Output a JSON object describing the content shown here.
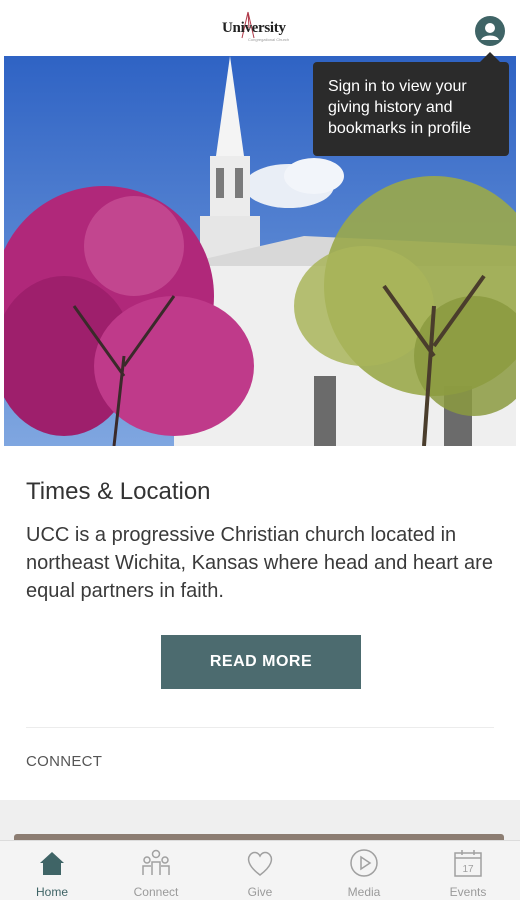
{
  "header": {
    "logo_text": "University",
    "logo_subtext": "Congregational Church",
    "profile_icon": "user-circle-icon"
  },
  "tooltip": {
    "text": "Sign in to view your giving history and bookmarks in profile"
  },
  "hero": {
    "image": "church-steeple-with-redbud-tree-photo"
  },
  "card": {
    "title": "Times & Location",
    "description": "UCC is a progressive Christian church located in northeast Wichita, Kansas where head and heart are equal partners in faith.",
    "read_more_label": "READ MORE",
    "section_label": "CONNECT"
  },
  "tabbar": {
    "active": "Home",
    "items": [
      {
        "label": "Home",
        "icon": "home-icon"
      },
      {
        "label": "Connect",
        "icon": "people-icon"
      },
      {
        "label": "Give",
        "icon": "heart-icon"
      },
      {
        "label": "Media",
        "icon": "play-icon"
      },
      {
        "label": "Events",
        "icon": "calendar-icon"
      }
    ],
    "events_date": "17"
  },
  "colors": {
    "accent": "#4c6b6f",
    "profile": "#3f6466",
    "tooltip_bg": "#2b2b2b"
  }
}
